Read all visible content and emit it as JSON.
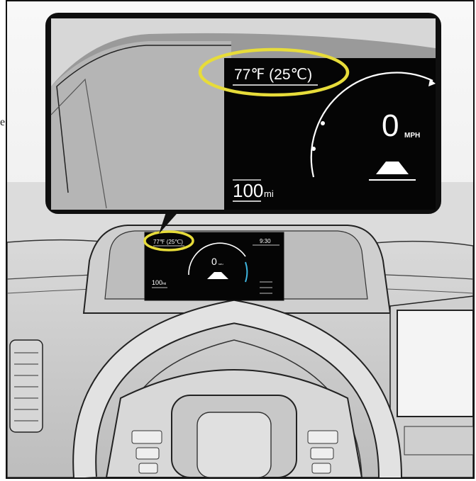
{
  "margin_fragment": "e",
  "zoom_display": {
    "outside_temperature": "77℉ (25℃)",
    "speed_value": "0",
    "speed_unit": "MPH",
    "range_value": "100",
    "range_unit": "mi"
  },
  "dash_display": {
    "outside_temperature": "77℉ (25℃)",
    "clock": "9:30",
    "speed_value": "0",
    "speed_unit": "MPH",
    "range_value": "100",
    "range_unit": "mi"
  },
  "colors": {
    "highlight": "#e7dc3a",
    "screen": "#050505",
    "gauge_accent": "#3fb6e0",
    "line_art": "#222222"
  }
}
